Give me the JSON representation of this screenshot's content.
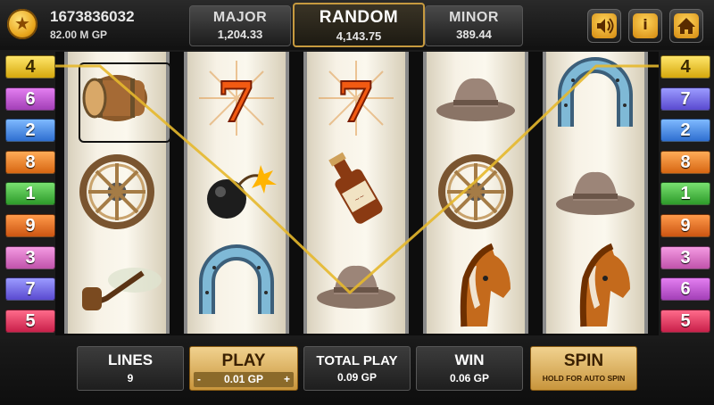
{
  "account": {
    "id": "1673836032",
    "balance": "82.00 M GP"
  },
  "jackpots": {
    "major": {
      "label": "MAJOR",
      "value": "1,204.33"
    },
    "random": {
      "label": "RANDOM",
      "value": "4,143.75"
    },
    "minor": {
      "label": "MINOR",
      "value": "389.44"
    }
  },
  "top_buttons": {
    "sound_icon": "speaker-icon",
    "info": "i",
    "home_icon": "home-icon"
  },
  "paylines_left": [
    "4",
    "6",
    "2",
    "8",
    "1",
    "9",
    "3",
    "7",
    "5"
  ],
  "paylines_right": [
    "4",
    "7",
    "2",
    "8",
    "1",
    "9",
    "3",
    "6",
    "5"
  ],
  "reels": [
    [
      "barrel",
      "wheel",
      "pipe"
    ],
    [
      "seven",
      "bomb",
      "horseshoe"
    ],
    [
      "seven",
      "whiskey",
      "hat"
    ],
    [
      "hat",
      "wheel",
      "horse"
    ],
    [
      "horseshoe",
      "hat",
      "horse"
    ]
  ],
  "winning_line": {
    "number": "4",
    "color": "#e6b82c"
  },
  "controls": {
    "lines": {
      "label": "LINES",
      "value": "9"
    },
    "play": {
      "label": "PLAY",
      "minus": "-",
      "value": "0.01 GP",
      "plus": "+"
    },
    "total_play": {
      "label": "TOTAL PLAY",
      "value": "0.09 GP"
    },
    "win": {
      "label": "WIN",
      "value": "0.06 GP"
    },
    "spin": {
      "label": "SPIN",
      "hint": "HOLD FOR AUTO SPIN"
    }
  }
}
